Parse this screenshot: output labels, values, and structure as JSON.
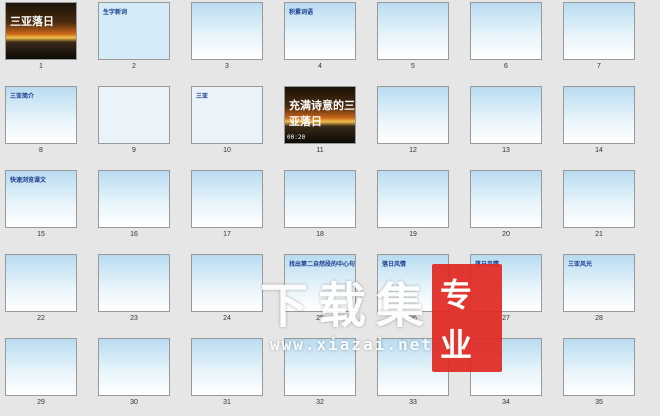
{
  "slides": [
    {
      "n": "1",
      "style": "sunset",
      "title": "三亚落日"
    },
    {
      "n": "2",
      "style": "pinyin",
      "title": "生字新词"
    },
    {
      "n": "3",
      "style": "sky",
      "title": ""
    },
    {
      "n": "4",
      "style": "sky",
      "title": "积累词语"
    },
    {
      "n": "5",
      "style": "sky",
      "title": ""
    },
    {
      "n": "6",
      "style": "sky",
      "title": ""
    },
    {
      "n": "7",
      "style": "sky",
      "title": ""
    },
    {
      "n": "8",
      "style": "sky",
      "title": "三亚简介"
    },
    {
      "n": "9",
      "style": "map",
      "title": ""
    },
    {
      "n": "10",
      "style": "map",
      "title": "三亚"
    },
    {
      "n": "11",
      "style": "sunset",
      "title": "充满诗意的三亚落日"
    },
    {
      "n": "12",
      "style": "sky",
      "title": ""
    },
    {
      "n": "13",
      "style": "sky",
      "title": ""
    },
    {
      "n": "14",
      "style": "sky",
      "title": ""
    },
    {
      "n": "15",
      "style": "sky",
      "title": "快速浏览课文"
    },
    {
      "n": "16",
      "style": "sky",
      "title": ""
    },
    {
      "n": "17",
      "style": "sky",
      "title": ""
    },
    {
      "n": "18",
      "style": "sky",
      "title": ""
    },
    {
      "n": "19",
      "style": "sky",
      "title": ""
    },
    {
      "n": "20",
      "style": "sky",
      "title": ""
    },
    {
      "n": "21",
      "style": "sky",
      "title": ""
    },
    {
      "n": "22",
      "style": "sky",
      "title": ""
    },
    {
      "n": "23",
      "style": "sky",
      "title": ""
    },
    {
      "n": "24",
      "style": "sky",
      "title": ""
    },
    {
      "n": "25",
      "style": "sky",
      "title": "找出第二自然段的中心句"
    },
    {
      "n": "26",
      "style": "sky",
      "title": "落日风情"
    },
    {
      "n": "27",
      "style": "sky",
      "title": "落日风情"
    },
    {
      "n": "28",
      "style": "sky",
      "title": "三亚风光"
    },
    {
      "n": "29",
      "style": "sky",
      "title": ""
    },
    {
      "n": "30",
      "style": "sky",
      "title": ""
    },
    {
      "n": "31",
      "style": "sky",
      "title": ""
    },
    {
      "n": "32",
      "style": "sky",
      "title": ""
    },
    {
      "n": "33",
      "style": "sky",
      "title": ""
    },
    {
      "n": "34",
      "style": "sky",
      "title": ""
    },
    {
      "n": "35",
      "style": "sky",
      "title": ""
    }
  ],
  "timer": "00:20",
  "watermark": {
    "main": "下载集",
    "badge_top": "专",
    "badge_bottom": "业",
    "url": "www.xiazai.net"
  }
}
